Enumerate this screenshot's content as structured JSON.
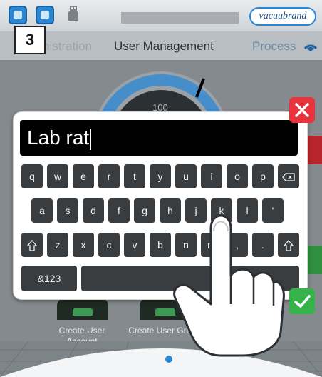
{
  "step_number": "3",
  "header": {
    "brand": "vacuubrand",
    "tabs": {
      "admin": "nistration",
      "user_management": "User Management",
      "process": "Process"
    }
  },
  "background": {
    "gauge_value": "100",
    "actions": [
      {
        "label": "Create User Account"
      },
      {
        "label": "Create User Group"
      }
    ]
  },
  "keyboard": {
    "input_value": "Lab rat",
    "row1": [
      "q",
      "w",
      "e",
      "r",
      "t",
      "y",
      "u",
      "i",
      "o",
      "p"
    ],
    "row2": [
      "a",
      "s",
      "d",
      "f",
      "g",
      "h",
      "j",
      "k",
      "l",
      "'"
    ],
    "row3": [
      "z",
      "x",
      "c",
      "v",
      "b",
      "n",
      "m",
      ",",
      "."
    ],
    "mode_key": "&123",
    "icons": {
      "backspace": "backspace-icon",
      "shift": "shift-icon",
      "close": "close-icon",
      "confirm": "checkmark-icon"
    }
  },
  "colors": {
    "accent_blue": "#2a87d6",
    "close_red": "#e8343c",
    "confirm_green": "#36b24a",
    "key_bg": "#3a3d40"
  }
}
